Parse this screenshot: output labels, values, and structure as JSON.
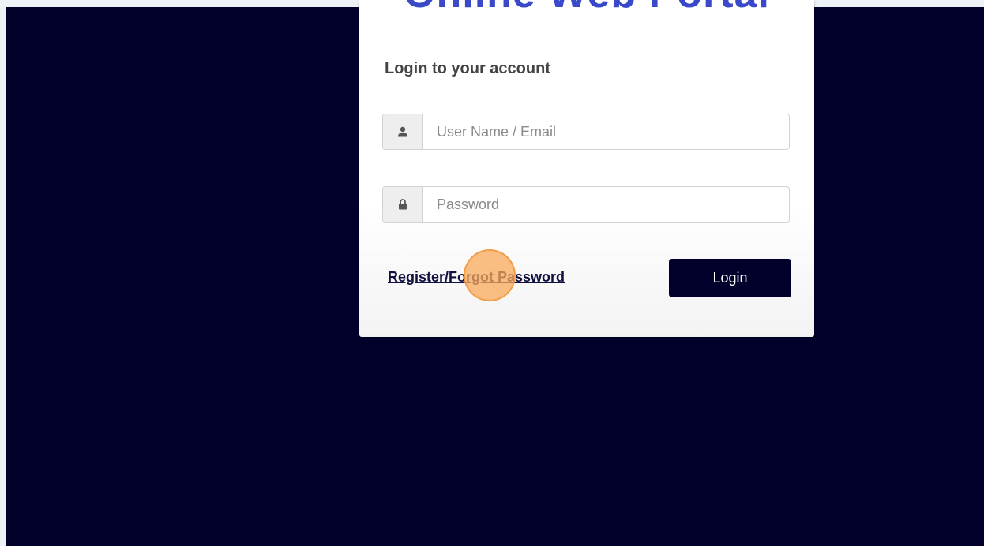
{
  "portal": {
    "title": "Online Web Portal"
  },
  "login": {
    "heading": "Login to your account",
    "username_placeholder": "User Name / Email",
    "password_placeholder": "Password",
    "register_link": "Register/Forgot Password",
    "login_button": "Login"
  },
  "icons": {
    "username": "user-icon",
    "password": "lock-icon"
  },
  "colors": {
    "background": "#00002b",
    "button": "#00002b",
    "title": "#3949c9",
    "click_indicator": "#faaa5a"
  }
}
